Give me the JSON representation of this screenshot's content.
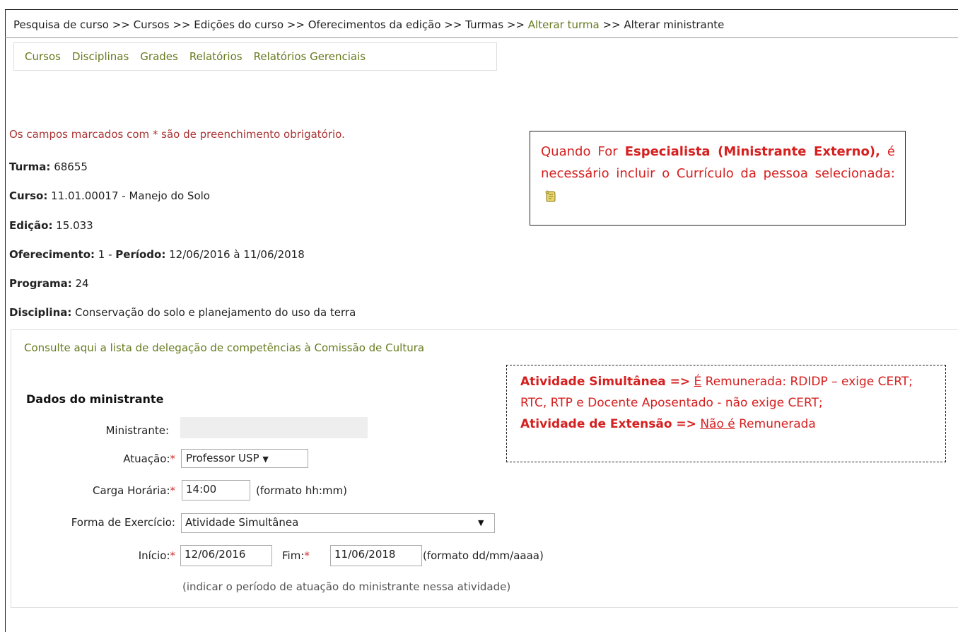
{
  "breadcrumb": {
    "part1": "Pesquisa de curso >> Cursos >> Edições do curso >> Oferecimentos da edição >> Turmas >> ",
    "link": "Alterar turma",
    "part2": " >> Alterar ministrante"
  },
  "menu": {
    "items": [
      "Cursos",
      "Disciplinas",
      "Grades",
      "Relatórios",
      "Relatórios Gerenciais"
    ]
  },
  "required_note": "Os campos marcados com * são de preenchimento obrigatório.",
  "info": {
    "turma_label": "Turma:",
    "turma_value": " 68655",
    "curso_label": "Curso:",
    "curso_value": " 11.01.00017 - Manejo do Solo",
    "edicao_label": "Edição:",
    "edicao_value": " 15.033",
    "oferecimento_label": "Oferecimento:",
    "oferecimento_value": " 1 - ",
    "periodo_label": "Período:",
    "periodo_value": " 12/06/2016 à 11/06/2018",
    "programa_label": "Programa:",
    "programa_value": " 24",
    "disciplina_label": "Disciplina:",
    "disciplina_value": " Conservação do solo e planejamento do uso da terra"
  },
  "callout1": {
    "text1": "Quando For ",
    "strong": "Especialista (Ministrante Externo),",
    "text2": " é necessário incluir o Currículo da pessoa selecionada:",
    "icon": "scroll-icon"
  },
  "panel": {
    "link": "Consulte aqui a lista de delegação de competências à Comissão de Cultura",
    "section_title": "Dados do ministrante"
  },
  "callout2": {
    "line1_strong": "Atividade Simultânea =>",
    "line1_u": "É",
    "line1_rest": " Remunerada: RDIDP – exige CERT;",
    "line2": "RTC, RTP e Docente Aposentado - não exige CERT;",
    "line3_strong": "Atividade de Extensão =>",
    "line3_u": "Não é",
    "line3_rest": " Remunerada"
  },
  "form": {
    "ministrante_label": "Ministrante:",
    "ministrante_value": "",
    "atuacao_label": "Atuação:",
    "atuacao_value": "Professor USP",
    "carga_label": "Carga Horária:",
    "carga_value": "14:00",
    "carga_hint": "(formato hh:mm)",
    "forma_label": "Forma de Exercício:",
    "forma_value": "Atividade Simultânea",
    "inicio_label": "Início:",
    "inicio_value": "12/06/2016",
    "fim_label": "Fim:",
    "fim_value": "11/06/2018",
    "data_hint": "(formato dd/mm/aaaa)",
    "periodo_hint": "(indicar o período de atuação do ministrante nessa atividade)",
    "required_mark": "*"
  },
  "colors": {
    "link": "#667a1e",
    "required": "#a33",
    "callout_text": "#d62020"
  }
}
